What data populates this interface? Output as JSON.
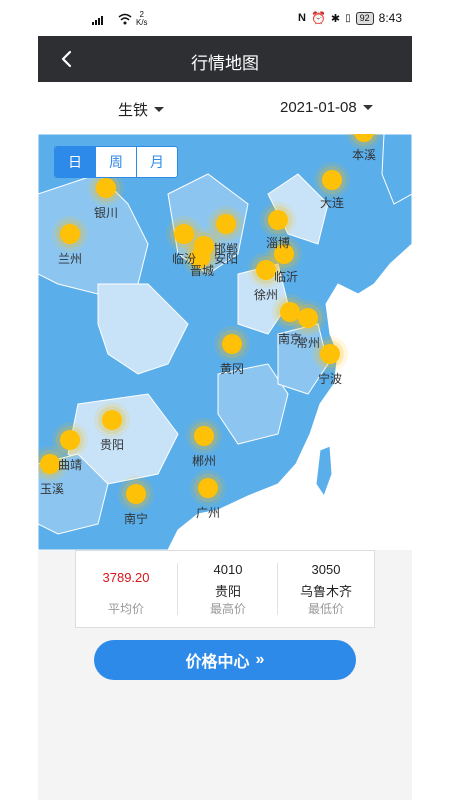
{
  "status_bar": {
    "net_icon": "signal-icon",
    "speed_value": "2",
    "speed_unit": "K/s",
    "battery": "92",
    "time": "8:43"
  },
  "header": {
    "title": "行情地图",
    "back_icon": "back-arrow-icon"
  },
  "filters": {
    "product": "生铁",
    "date": "2021-01-08"
  },
  "period_tabs": [
    "日",
    "周",
    "月"
  ],
  "map": {
    "colors": {
      "sea": "#ffffff",
      "land_dark": "#5aaeea",
      "land_mid": "#8cc6f0",
      "land_light": "#c8e3f8",
      "border": "#ffffff",
      "marker": "#ffc107"
    },
    "cities": [
      {
        "name": "本溪"
      },
      {
        "name": "大连"
      },
      {
        "name": "银川"
      },
      {
        "name": "兰州"
      },
      {
        "name": "临汾"
      },
      {
        "name": "邯郸"
      },
      {
        "name": "安阳"
      },
      {
        "name": "晋城"
      },
      {
        "name": "淄博"
      },
      {
        "name": "临沂"
      },
      {
        "name": "徐州"
      },
      {
        "name": "南京"
      },
      {
        "name": "常州"
      },
      {
        "name": "宁波"
      },
      {
        "name": "黄冈"
      },
      {
        "name": "贵阳"
      },
      {
        "name": "曲靖"
      },
      {
        "name": "玉溪"
      },
      {
        "name": "郴州"
      },
      {
        "name": "南宁"
      },
      {
        "name": "广州"
      }
    ]
  },
  "summary": {
    "average": {
      "value": "3789.20",
      "label": "平均价",
      "color": "#d9161b"
    },
    "highest": {
      "value": "4010",
      "city": "贵阳",
      "label": "最高价"
    },
    "lowest": {
      "value": "3050",
      "city": "乌鲁木齐",
      "label": "最低价"
    }
  },
  "cta": {
    "label": "价格中心",
    "icon": "double-chevron-right-icon"
  }
}
